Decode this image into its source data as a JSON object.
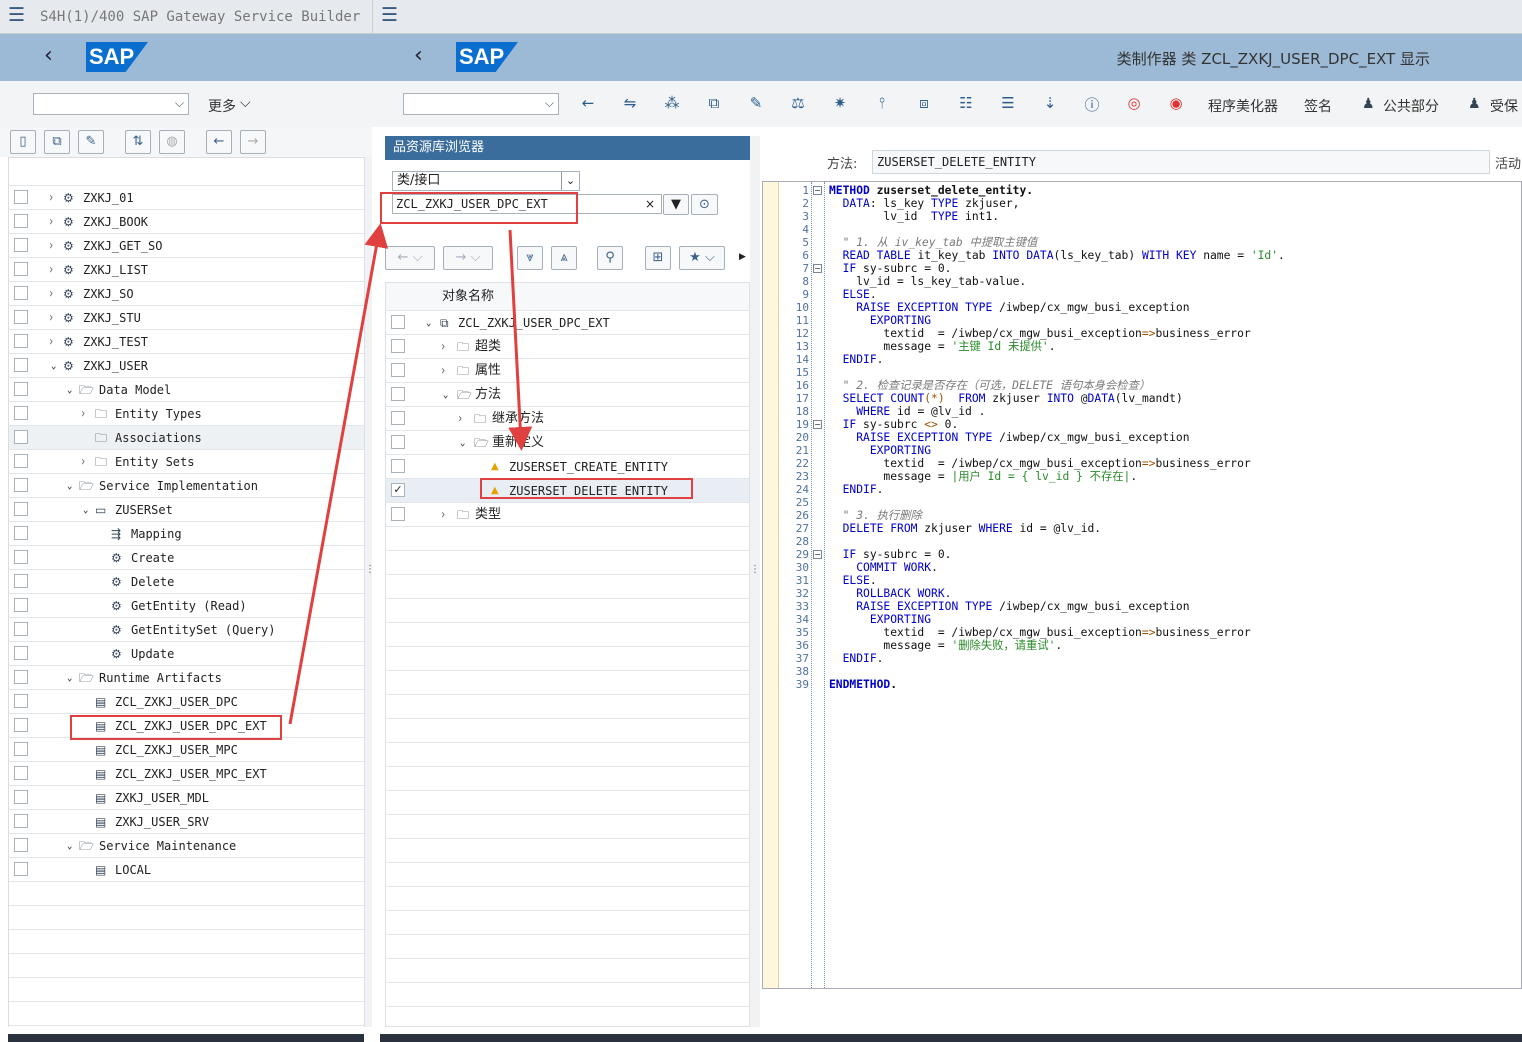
{
  "window": {
    "title": "S4H(1)/400 SAP Gateway Service Builder"
  },
  "left": {
    "more_label": "更多",
    "tree": [
      {
        "label": "ZXKJ_01",
        "indent": 0,
        "caret": ">",
        "icon": "service-icon"
      },
      {
        "label": "ZXKJ_BOOK",
        "indent": 0,
        "caret": ">",
        "icon": "service-icon"
      },
      {
        "label": "ZXKJ_GET_SO",
        "indent": 0,
        "caret": ">",
        "icon": "service-icon"
      },
      {
        "label": "ZXKJ_LIST",
        "indent": 0,
        "caret": ">",
        "icon": "service-icon"
      },
      {
        "label": "ZXKJ_SO",
        "indent": 0,
        "caret": ">",
        "icon": "service-icon"
      },
      {
        "label": "ZXKJ_STU",
        "indent": 0,
        "caret": ">",
        "icon": "service-icon"
      },
      {
        "label": "ZXKJ_TEST",
        "indent": 0,
        "caret": ">",
        "icon": "service-icon"
      },
      {
        "label": "ZXKJ_USER",
        "indent": 0,
        "caret": "v",
        "icon": "service-icon"
      },
      {
        "label": "Data Model",
        "indent": 1,
        "caret": "v",
        "icon": "folder-open-icon"
      },
      {
        "label": "Entity Types",
        "indent": 2,
        "caret": ">",
        "icon": "folder-icon"
      },
      {
        "label": "Associations",
        "indent": 2,
        "caret": "",
        "icon": "folder-icon"
      },
      {
        "label": "Entity Sets",
        "indent": 2,
        "caret": ">",
        "icon": "folder-icon"
      },
      {
        "label": "Service Implementation",
        "indent": 1,
        "caret": "v",
        "icon": "folder-open-icon"
      },
      {
        "label": "ZUSERSet",
        "indent": 2,
        "caret": "v",
        "icon": "entityset-icon"
      },
      {
        "label": "Mapping",
        "indent": 3,
        "caret": "",
        "icon": "mapping-icon"
      },
      {
        "label": "Create",
        "indent": 3,
        "caret": "",
        "icon": "operation-icon"
      },
      {
        "label": "Delete",
        "indent": 3,
        "caret": "",
        "icon": "operation-icon"
      },
      {
        "label": "GetEntity (Read)",
        "indent": 3,
        "caret": "",
        "icon": "operation-icon"
      },
      {
        "label": "GetEntitySet (Query)",
        "indent": 3,
        "caret": "",
        "icon": "operation-icon"
      },
      {
        "label": "Update",
        "indent": 3,
        "caret": "",
        "icon": "operation-icon"
      },
      {
        "label": "Runtime Artifacts",
        "indent": 1,
        "caret": "v",
        "icon": "folder-open-icon"
      },
      {
        "label": "ZCL_ZXKJ_USER_DPC",
        "indent": 2,
        "caret": "",
        "icon": "document-icon"
      },
      {
        "label": "ZCL_ZXKJ_USER_DPC_EXT",
        "indent": 2,
        "caret": "",
        "icon": "document-icon"
      },
      {
        "label": "ZCL_ZXKJ_USER_MPC",
        "indent": 2,
        "caret": "",
        "icon": "document-icon"
      },
      {
        "label": "ZCL_ZXKJ_USER_MPC_EXT",
        "indent": 2,
        "caret": "",
        "icon": "document-icon"
      },
      {
        "label": "ZXKJ_USER_MDL",
        "indent": 2,
        "caret": "",
        "icon": "document-icon"
      },
      {
        "label": "ZXKJ_USER_SRV",
        "indent": 2,
        "caret": "",
        "icon": "document-icon"
      },
      {
        "label": "Service Maintenance",
        "indent": 1,
        "caret": "v",
        "icon": "folder-open-icon"
      },
      {
        "label": "LOCAL",
        "indent": 2,
        "caret": "",
        "icon": "document-icon"
      }
    ]
  },
  "right": {
    "header_title": "类制作器 类 ZCL_ZXKJ_USER_DPC_EXT 显示",
    "toolbar": {
      "pretty_printer": "程序美化器",
      "signature": "签名",
      "public_section": "公共部分",
      "protected_section": "受保"
    },
    "repo": {
      "title": "资源库浏览器",
      "type_select": "类/接口",
      "class_input": "ZCL_ZXKJ_USER_DPC_EXT",
      "column_header": "对象名称",
      "tree": [
        {
          "label": "ZCL_ZXKJ_USER_DPC_EXT",
          "indent": 0,
          "caret": "v",
          "icon": "class-icon",
          "check": false
        },
        {
          "label": "超类",
          "indent": 1,
          "caret": ">",
          "icon": "folder-icon",
          "check": false
        },
        {
          "label": "属性",
          "indent": 1,
          "caret": ">",
          "icon": "folder-icon",
          "check": false
        },
        {
          "label": "方法",
          "indent": 1,
          "caret": "v",
          "icon": "folder-open-icon",
          "check": false
        },
        {
          "label": "继承方法",
          "indent": 2,
          "caret": ">",
          "icon": "folder-icon",
          "check": false
        },
        {
          "label": "重新定义",
          "indent": 2,
          "caret": "v",
          "icon": "folder-open-icon",
          "check": false
        },
        {
          "label": "ZUSERSET_CREATE_ENTITY",
          "indent": 3,
          "caret": "",
          "icon": "warning-icon",
          "check": false
        },
        {
          "label": "ZUSERSET_DELETE_ENTITY",
          "indent": 3,
          "caret": "",
          "icon": "warning-icon",
          "check": true
        },
        {
          "label": "类型",
          "indent": 1,
          "caret": ">",
          "icon": "folder-icon",
          "check": false
        }
      ]
    },
    "method_label": "方法:",
    "method_value": "ZUSERSET_DELETE_ENTITY",
    "status": "活动",
    "code": [
      "METHOD zuserset_delete_entity.",
      "  DATA: ls_key TYPE zkjuser,",
      "        lv_id  TYPE int1.",
      "",
      "  \" 1. 从 iv_key_tab 中提取主键值",
      "  READ TABLE it_key_tab INTO DATA(ls_key_tab) WITH KEY name = 'Id'.",
      "  IF sy-subrc = 0.",
      "    lv_id = ls_key_tab-value.",
      "  ELSE.",
      "    RAISE EXCEPTION TYPE /iwbep/cx_mgw_busi_exception",
      "      EXPORTING",
      "        textid  = /iwbep/cx_mgw_busi_exception=>business_error",
      "        message = '主键 Id 未提供'.",
      "  ENDIF.",
      "",
      "  \" 2. 检查记录是否存在（可选，DELETE 语句本身会检查）",
      "  SELECT COUNT(*)  FROM zkjuser INTO @DATA(lv_mandt)",
      "    WHERE id = @lv_id .",
      "  IF sy-subrc <> 0.",
      "    RAISE EXCEPTION TYPE /iwbep/cx_mgw_busi_exception",
      "      EXPORTING",
      "        textid  = /iwbep/cx_mgw_busi_exception=>business_error",
      "        message = |用户 Id = { lv_id } 不存在|.",
      "  ENDIF.",
      "",
      "  \" 3. 执行删除",
      "  DELETE FROM zkjuser WHERE id = @lv_id.",
      "",
      "  IF sy-subrc = 0.",
      "    COMMIT WORK.",
      "  ELSE.",
      "    ROLLBACK WORK.",
      "    RAISE EXCEPTION TYPE /iwbep/cx_mgw_busi_exception",
      "      EXPORTING",
      "        textid  = /iwbep/cx_mgw_busi_exception=>business_error",
      "        message = '删除失败，请重试'.",
      "  ENDIF.",
      "",
      "ENDMETHOD."
    ]
  },
  "colors": {
    "sap_bar": "#9cbad5",
    "highlight": "#e04040",
    "keyword": "#0000c8",
    "string": "#2a8a2a"
  }
}
